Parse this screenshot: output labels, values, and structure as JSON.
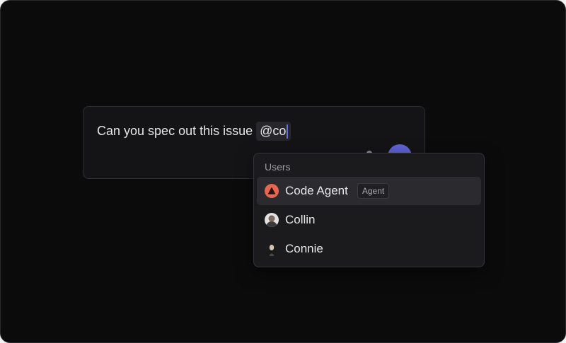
{
  "composer": {
    "text": "Can you spec out this issue",
    "mention_text": "@co"
  },
  "dropdown": {
    "header": "Users",
    "options": [
      {
        "label": "Code Agent",
        "tag": "Agent",
        "icon": "agent-triangle-icon",
        "selected": true
      },
      {
        "label": "Collin",
        "icon": "avatar-photo"
      },
      {
        "label": "Connie",
        "icon": "avatar-photo"
      }
    ]
  },
  "colors": {
    "background": "#0b0b0c",
    "accent": "#5e63d4",
    "agent_icon": "#e6664f"
  }
}
